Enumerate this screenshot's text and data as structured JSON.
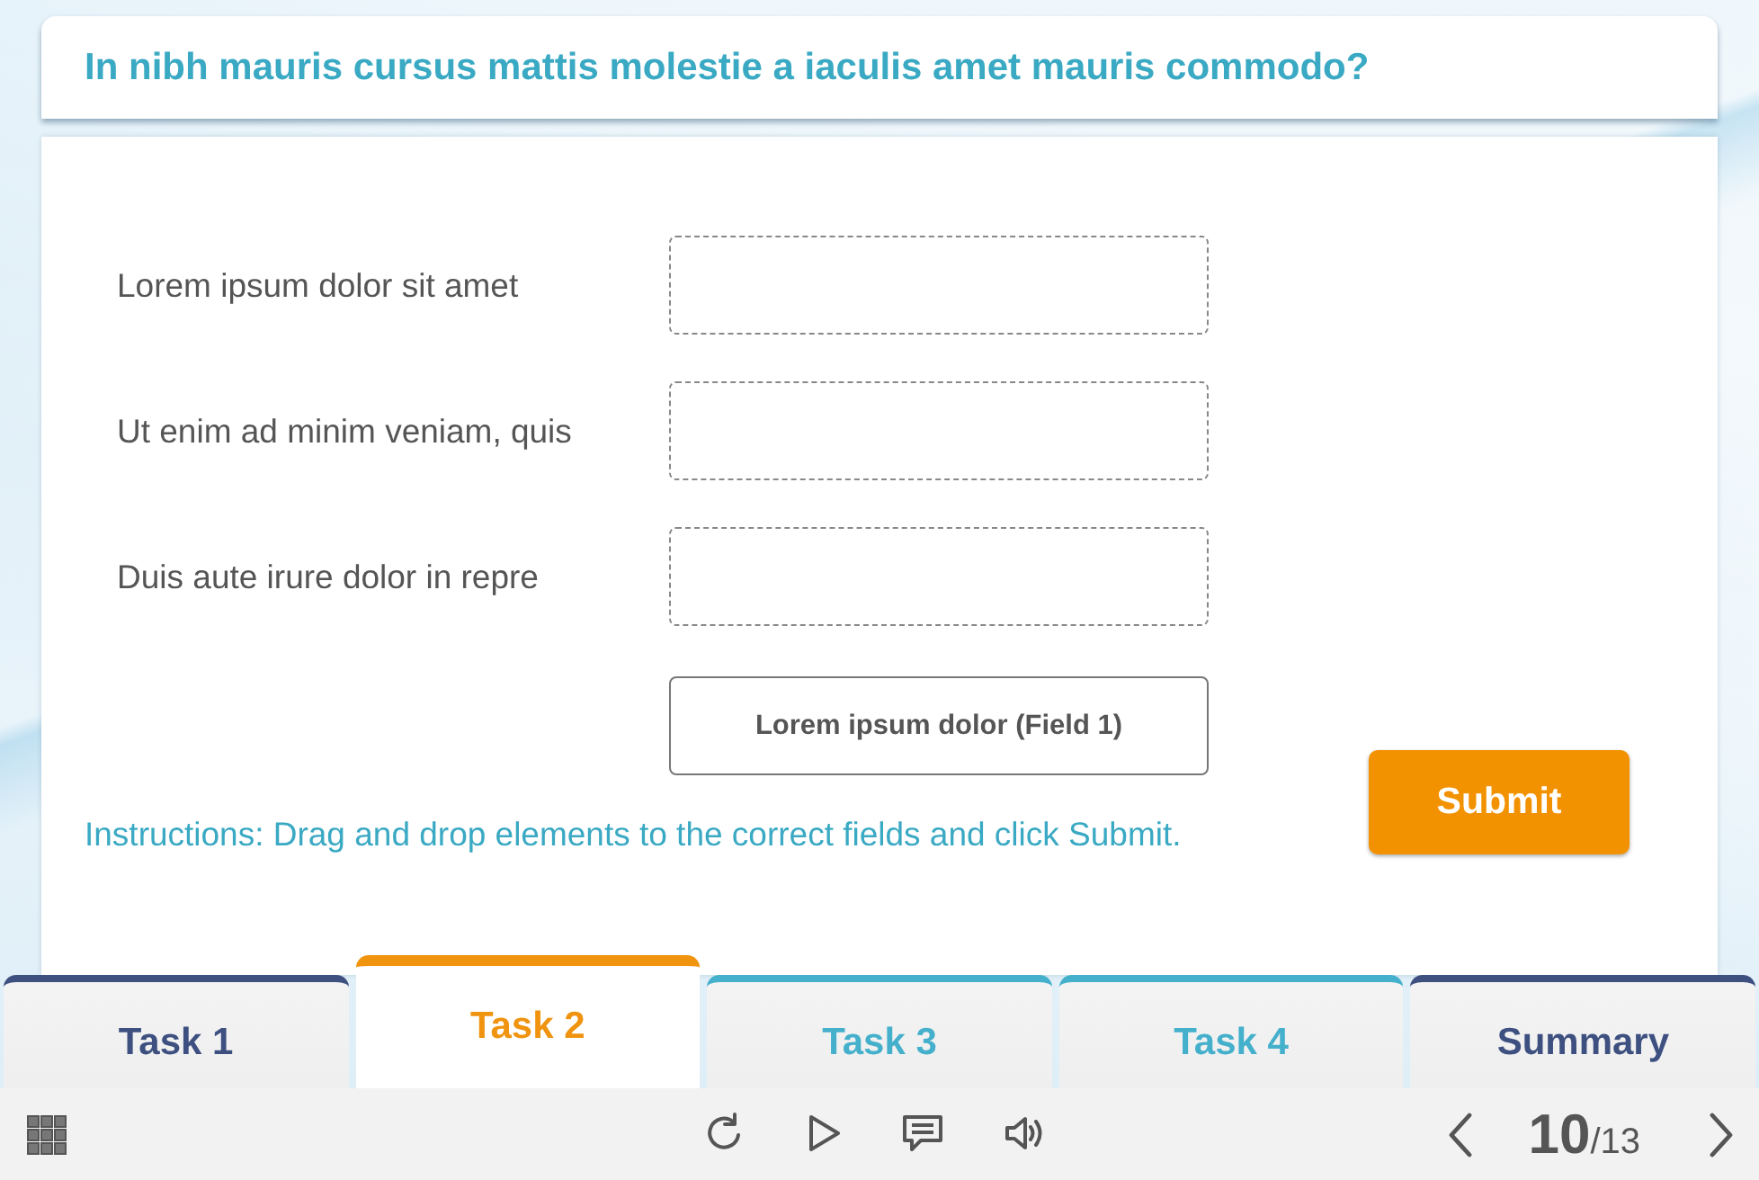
{
  "question": {
    "title": "In nibh mauris cursus mattis molestie a iaculis amet mauris commodo?"
  },
  "matching": {
    "rows": [
      {
        "label": "Lorem ipsum dolor sit amet"
      },
      {
        "label": "Ut enim ad minim veniam, quis"
      },
      {
        "label": "Duis aute irure dolor in repre"
      }
    ],
    "drag_items": [
      {
        "label": "Lorem ipsum dolor (Field 1)"
      }
    ],
    "instructions": "Instructions: Drag and drop elements to the correct fields and click Submit.",
    "submit_button": {
      "label": "Submit"
    }
  },
  "tabs": [
    {
      "label": "Task 1",
      "selected": false,
      "color": "#3d5080"
    },
    {
      "label": "Task 2",
      "selected": true,
      "color": "#f0930f"
    },
    {
      "label": "Task 3",
      "selected": false,
      "color": "#45b0cc"
    },
    {
      "label": "Task 4",
      "selected": false,
      "color": "#45b0cc"
    },
    {
      "label": "Summary",
      "selected": false,
      "color": "#3d5080"
    }
  ],
  "player_bar": {
    "pager": {
      "current": "10",
      "total": "/13"
    }
  }
}
